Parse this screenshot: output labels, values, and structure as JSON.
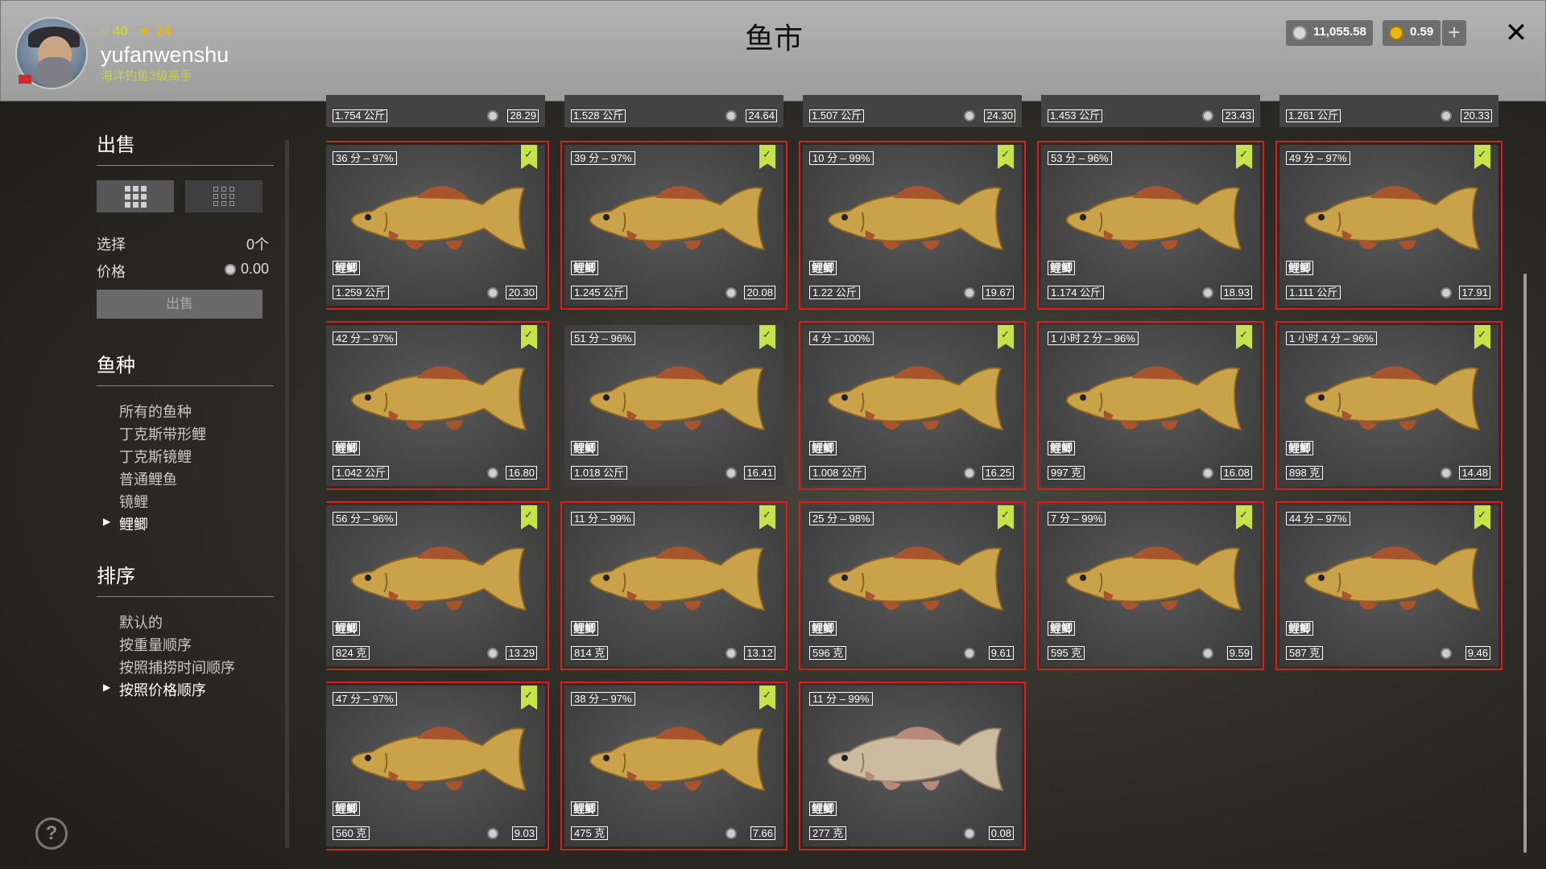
{
  "header": {
    "title": "鱼市",
    "username": "yufanwenshu",
    "subtitle": "海洋钓鱼3级高手",
    "level": "40",
    "stars": "24",
    "silver": "11,055.58",
    "gold": "0.59",
    "plus": "+",
    "close": "✕",
    "colors": {
      "accent_level": "#c6d23a",
      "accent_gold": "#e8b619",
      "selection": "#e01b1b"
    }
  },
  "sidebar": {
    "sell_title": "出售",
    "select_label": "选择",
    "select_value": "0个",
    "price_label": "价格",
    "price_value": "0.00",
    "sell_button": "出售",
    "species_title": "鱼种",
    "species": [
      {
        "label": "所有的鱼种",
        "active": false
      },
      {
        "label": "丁克斯带形鲤",
        "active": false
      },
      {
        "label": "丁克斯镜鲤",
        "active": false
      },
      {
        "label": "普通鲤鱼",
        "active": false
      },
      {
        "label": "镜鲤",
        "active": false
      },
      {
        "label": "鲤鲫",
        "active": true
      }
    ],
    "sort_title": "排序",
    "sort": [
      {
        "label": "默认的",
        "active": false
      },
      {
        "label": "按重量顺序",
        "active": false
      },
      {
        "label": "按照捕捞时间顺序",
        "active": false
      },
      {
        "label": "按照价格顺序",
        "active": true
      }
    ],
    "help": "?"
  },
  "partial_row": [
    {
      "weight": "1.754 公斤",
      "price": "28.29"
    },
    {
      "weight": "1.528 公斤",
      "price": "24.64"
    },
    {
      "weight": "1.507 公斤",
      "price": "24.30"
    },
    {
      "weight": "1.453 公斤",
      "price": "23.43"
    },
    {
      "weight": "1.261 公斤",
      "price": "20.33"
    }
  ],
  "fish": [
    {
      "time": "36 分 – 97%",
      "species": "鲤鲫",
      "weight": "1.259 公斤",
      "price": "20.30",
      "checked": true,
      "selected": true
    },
    {
      "time": "39 分 – 97%",
      "species": "鲤鲫",
      "weight": "1.245 公斤",
      "price": "20.08",
      "checked": true,
      "selected": true
    },
    {
      "time": "10 分 – 99%",
      "species": "鲤鲫",
      "weight": "1.22 公斤",
      "price": "19.67",
      "checked": true,
      "selected": true
    },
    {
      "time": "53 分 – 96%",
      "species": "鲤鲫",
      "weight": "1.174 公斤",
      "price": "18.93",
      "checked": true,
      "selected": true
    },
    {
      "time": "49 分 – 97%",
      "species": "鲤鲫",
      "weight": "1.111 公斤",
      "price": "17.91",
      "checked": true,
      "selected": true
    },
    {
      "time": "42 分 – 97%",
      "species": "鲤鲫",
      "weight": "1.042 公斤",
      "price": "16.80",
      "checked": true,
      "selected": true
    },
    {
      "time": "51 分 – 96%",
      "species": "鲤鲫",
      "weight": "1.018 公斤",
      "price": "16.41",
      "checked": true,
      "selected": false
    },
    {
      "time": "4 分 – 100%",
      "species": "鲤鲫",
      "weight": "1.008 公斤",
      "price": "16.25",
      "checked": true,
      "selected": true
    },
    {
      "time": "1 小时 2 分 – 96%",
      "species": "鲤鲫",
      "weight": "997 克",
      "price": "16.08",
      "checked": true,
      "selected": true
    },
    {
      "time": "1 小时 4 分 – 96%",
      "species": "鲤鲫",
      "weight": "898 克",
      "price": "14.48",
      "checked": true,
      "selected": true
    },
    {
      "time": "56 分 – 96%",
      "species": "鲤鲫",
      "weight": "824 克",
      "price": "13.29",
      "checked": true,
      "selected": true
    },
    {
      "time": "11 分 – 99%",
      "species": "鲤鲫",
      "weight": "814 克",
      "price": "13.12",
      "checked": true,
      "selected": true
    },
    {
      "time": "25 分 – 98%",
      "species": "鲤鲫",
      "weight": "596 克",
      "price": "9.61",
      "checked": true,
      "selected": true
    },
    {
      "time": "7 分 – 99%",
      "species": "鲤鲫",
      "weight": "595 克",
      "price": "9.59",
      "checked": true,
      "selected": true
    },
    {
      "time": "44 分 – 97%",
      "species": "鲤鲫",
      "weight": "587 克",
      "price": "9.46",
      "checked": true,
      "selected": true
    },
    {
      "time": "47 分 – 97%",
      "species": "鲤鲫",
      "weight": "560 克",
      "price": "9.03",
      "checked": true,
      "selected": true
    },
    {
      "time": "38 分 – 97%",
      "species": "鲤鲫",
      "weight": "475 克",
      "price": "7.66",
      "checked": true,
      "selected": true
    },
    {
      "time": "11 分 – 99%",
      "species": "鲤鲫",
      "weight": "277 克",
      "price": "0.08",
      "checked": false,
      "selected": true,
      "pale": true
    }
  ]
}
